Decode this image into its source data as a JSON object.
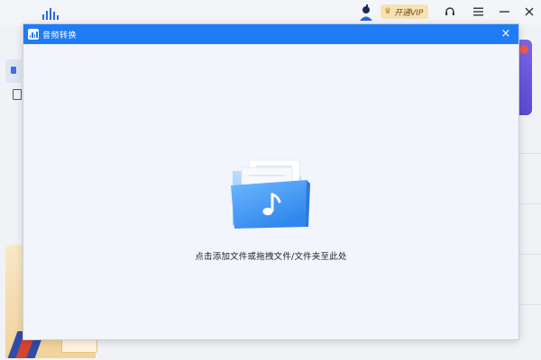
{
  "app": {
    "vip_label": "开通VIP"
  },
  "dialog": {
    "title": "音频转换",
    "close_glyph": "×",
    "drop_hint": "点击添加文件或拖拽文件/文件夹至此处"
  },
  "icons": {
    "app_logo": "audio-waveform-icon",
    "folder": "music-folder-icon",
    "service": "headset-icon",
    "menu": "menu-icon",
    "minimize": "minimize-icon",
    "close": "close-icon"
  },
  "colors": {
    "title_bar": "#1f7cf5",
    "dialog_bg": "#f2f5fb",
    "vip_bg": "#f6e3b5",
    "folder_blue": "#4a9ff5"
  }
}
